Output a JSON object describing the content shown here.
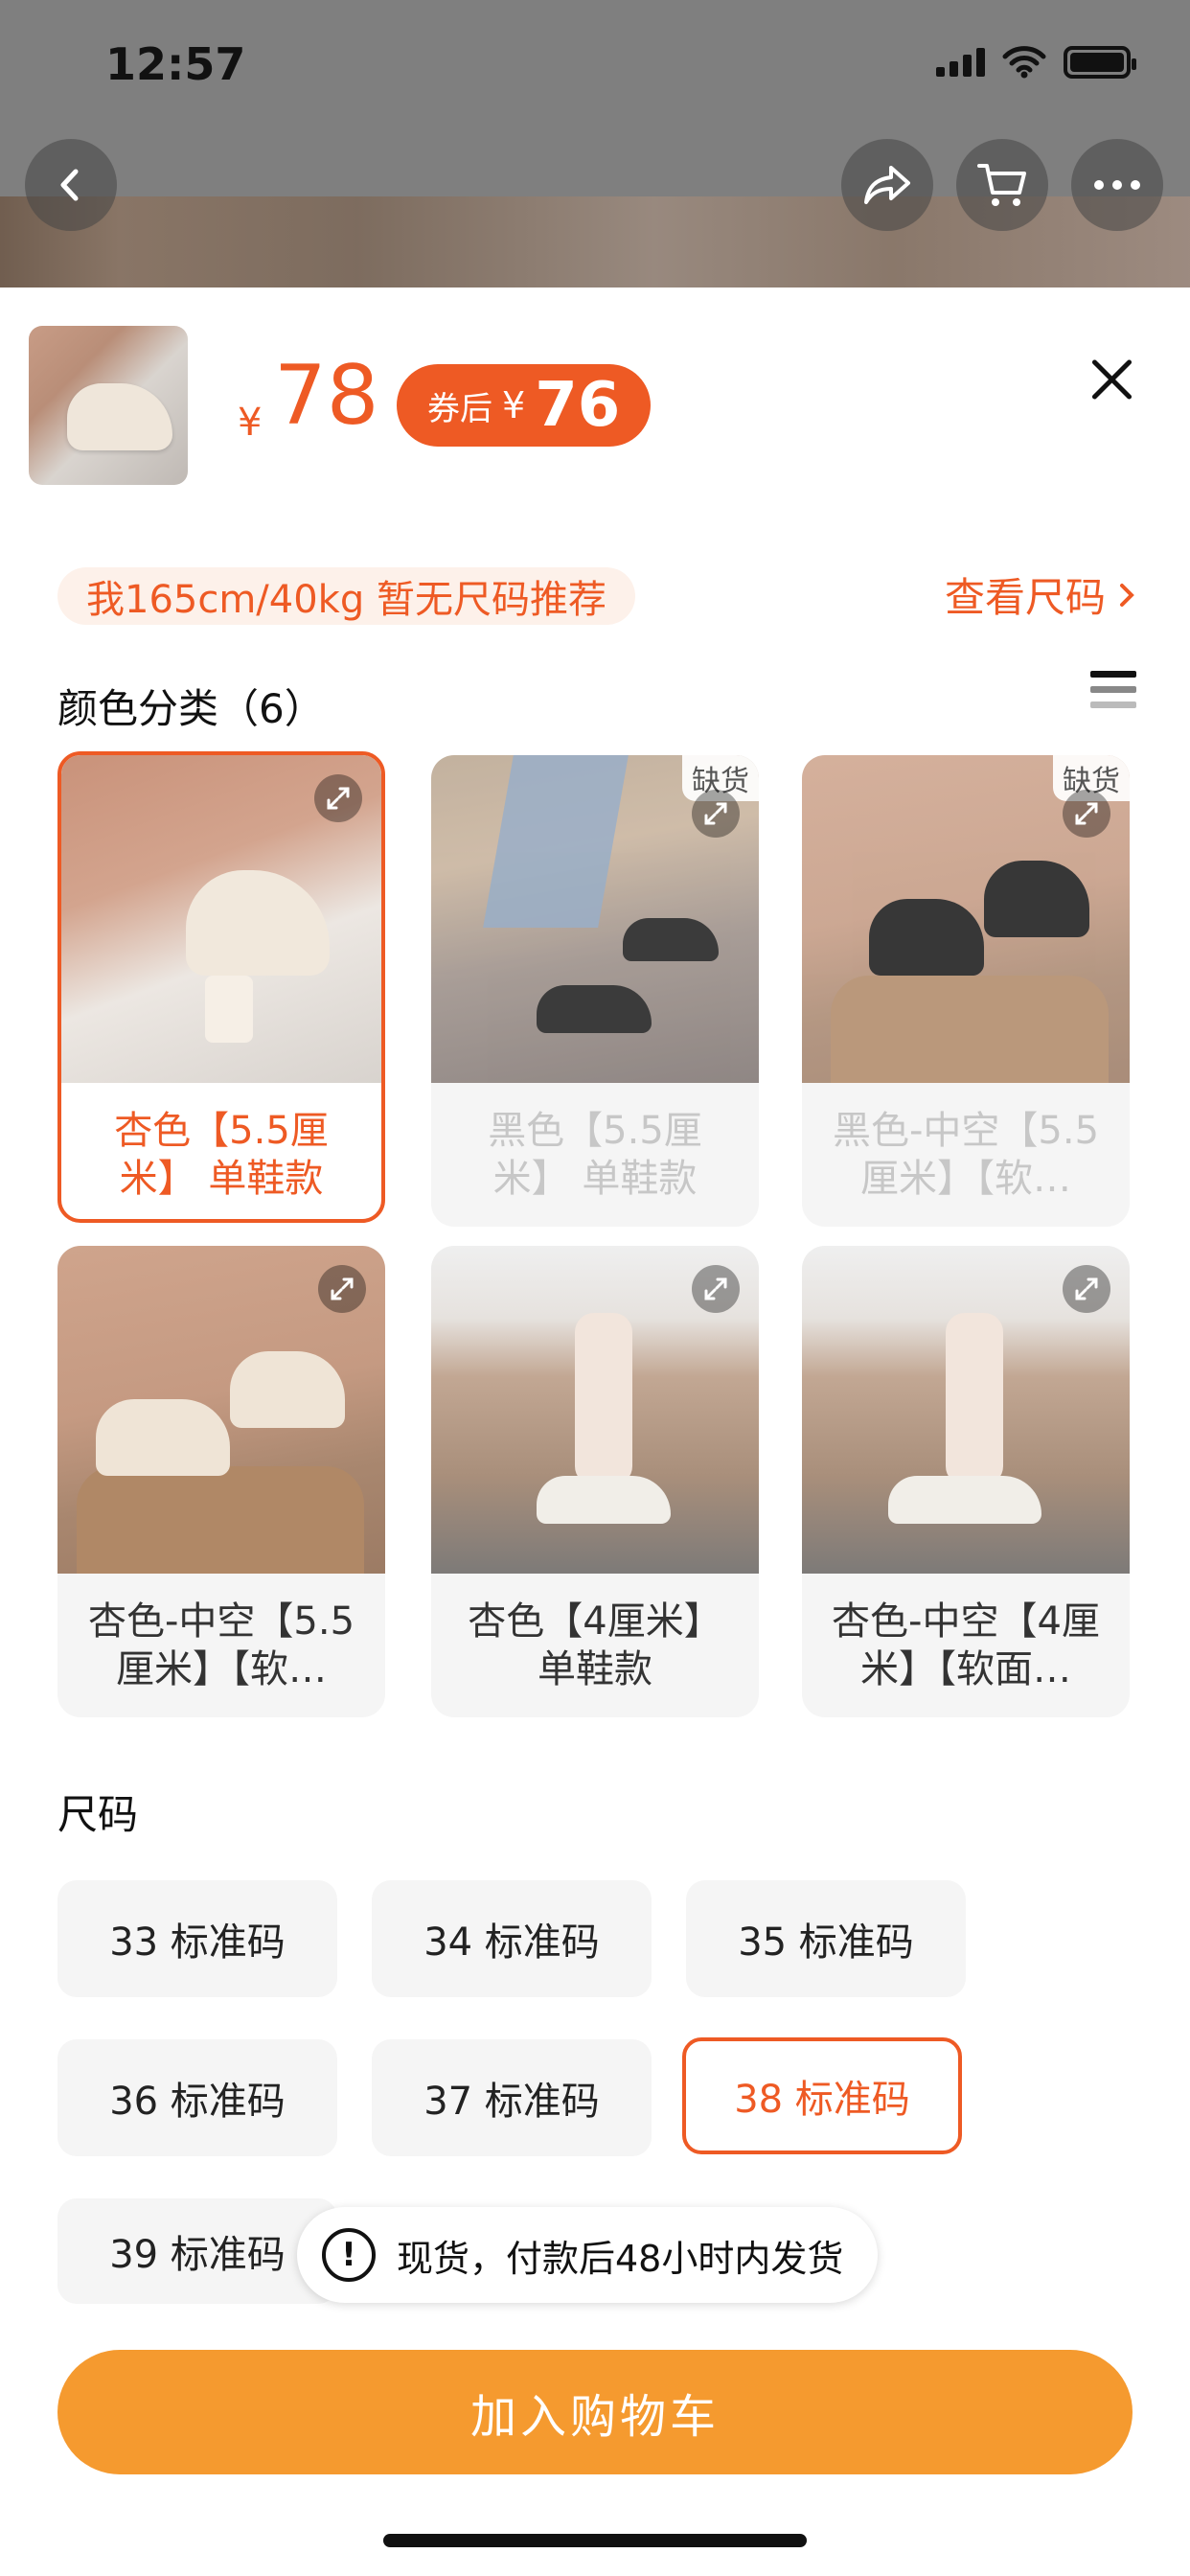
{
  "status_bar": {
    "time": "12:57"
  },
  "header_buttons": [
    "back-icon",
    "share-icon",
    "cart-icon",
    "more-icon"
  ],
  "product": {
    "price_currency": "¥",
    "price": "78",
    "coupon_label": "券后",
    "coupon_currency": "¥",
    "coupon_price": "76"
  },
  "size_hint": {
    "recommendation": "我165cm/40kg  暂无尺码推荐",
    "view_link": "查看尺码"
  },
  "color_section": {
    "title": "颜色分类（6）",
    "items": [
      {
        "label": "杏色【5.5厘米】 单鞋款",
        "state": "selected",
        "out_of_stock": ""
      },
      {
        "label": "黑色【5.5厘米】 单鞋款",
        "state": "disabled",
        "out_of_stock": "缺货"
      },
      {
        "label": "黑色-中空【5.5厘米】【软…",
        "state": "disabled",
        "out_of_stock": "缺货"
      },
      {
        "label": "杏色-中空【5.5厘米】【软…",
        "state": "normal",
        "out_of_stock": ""
      },
      {
        "label": "杏色【4厘米】 单鞋款",
        "state": "normal",
        "out_of_stock": ""
      },
      {
        "label": "杏色-中空【4厘米】【软面…",
        "state": "normal",
        "out_of_stock": ""
      }
    ]
  },
  "size_section": {
    "title": "尺码",
    "sizes": [
      "33 标准码",
      "34 标准码",
      "35 标准码",
      "36 标准码",
      "37 标准码",
      "38 标准码",
      "39 标准码"
    ],
    "selected": "38 标准码"
  },
  "toast": {
    "text": "现货，付款后48小时内发货"
  },
  "cta": {
    "label": "加入购物车"
  },
  "colors": {
    "accent": "#ee5a24",
    "cta_bg": "#f59a2f",
    "disabled_text": "#c7c7c7"
  }
}
